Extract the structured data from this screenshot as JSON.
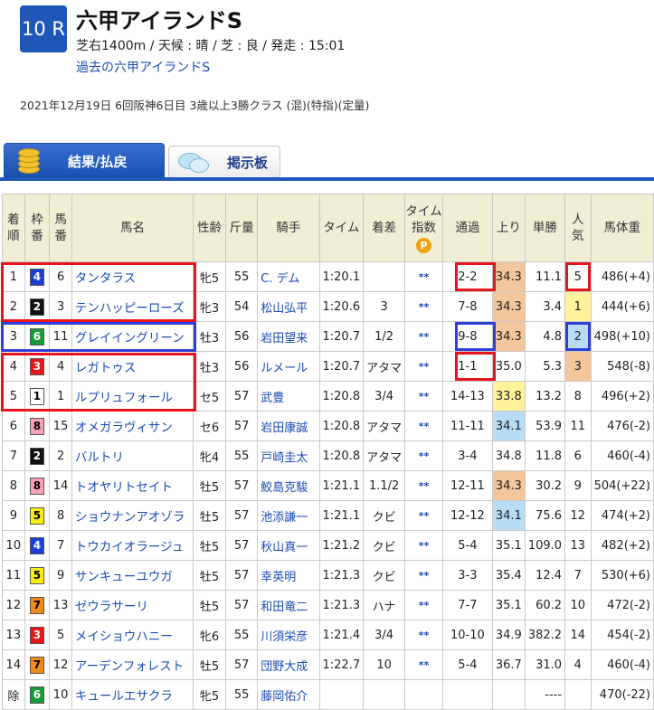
{
  "race": {
    "number": "10 R",
    "title": "六甲アイランドS",
    "info": "芝右1400m / 天候 : 晴 / 芝 : 良 / 発走 : 15:01",
    "past_link": "過去の六甲アイランドS",
    "date_line": "2021年12月19日 6回阪神6日目 3歳以上3勝クラス (混)(特指)(定量)"
  },
  "tabs": [
    {
      "label": "結果/払戻",
      "active": true,
      "icon": "coin-stack-icon"
    },
    {
      "label": "掲示板",
      "active": false,
      "icon": "speech-bubble-icon"
    }
  ],
  "table": {
    "headers": {
      "rank": "着\n順",
      "waku": "枠\n番",
      "umaban": "馬\n番",
      "name": "馬名",
      "sexage": "性齢",
      "weight": "斤量",
      "jockey": "騎手",
      "time": "タイム",
      "margin": "着差",
      "index": "タイム\n指数",
      "passing": "通過",
      "last3f": "上り",
      "odds": "単勝",
      "pop": "人\n気",
      "bodyweight": "馬体重"
    },
    "rows": [
      {
        "rank": "1",
        "waku": "4",
        "umaban": "6",
        "name": "タンタラス",
        "sexage": "牝5",
        "weight": "55",
        "jockey": "C. デム",
        "time": "1:20.1",
        "margin": "",
        "index": "**",
        "passing": "2-2",
        "last3f": "34.3",
        "odds": "11.1",
        "pop": "5",
        "bodyweight": "486(+4)"
      },
      {
        "rank": "2",
        "waku": "2",
        "umaban": "3",
        "name": "テンハッピーローズ",
        "sexage": "牝3",
        "weight": "54",
        "jockey": "松山弘平",
        "time": "1:20.6",
        "margin": "3",
        "index": "**",
        "passing": "7-8",
        "last3f": "34.3",
        "odds": "3.4",
        "pop": "1",
        "bodyweight": "444(+6)"
      },
      {
        "rank": "3",
        "waku": "6",
        "umaban": "11",
        "name": "グレイイングリーン",
        "sexage": "牡3",
        "weight": "56",
        "jockey": "岩田望来",
        "time": "1:20.7",
        "margin": "1/2",
        "index": "**",
        "passing": "9-8",
        "last3f": "34.3",
        "odds": "4.8",
        "pop": "2",
        "bodyweight": "498(+10)"
      },
      {
        "rank": "4",
        "waku": "3",
        "umaban": "4",
        "name": "レガトゥス",
        "sexage": "牡3",
        "weight": "56",
        "jockey": "ルメール",
        "time": "1:20.7",
        "margin": "アタマ",
        "index": "**",
        "passing": "1-1",
        "last3f": "35.0",
        "odds": "5.3",
        "pop": "3",
        "bodyweight": "548(-8)"
      },
      {
        "rank": "5",
        "waku": "1",
        "umaban": "1",
        "name": "ルプリュフォール",
        "sexage": "セ5",
        "weight": "57",
        "jockey": "武豊",
        "time": "1:20.8",
        "margin": "3/4",
        "index": "**",
        "passing": "14-13",
        "last3f": "33.8",
        "odds": "13.2",
        "pop": "8",
        "bodyweight": "496(+2)"
      },
      {
        "rank": "6",
        "waku": "8",
        "umaban": "15",
        "name": "オメガラヴィサン",
        "sexage": "セ6",
        "weight": "57",
        "jockey": "岩田康誠",
        "time": "1:20.8",
        "margin": "アタマ",
        "index": "**",
        "passing": "11-11",
        "last3f": "34.1",
        "odds": "53.9",
        "pop": "11",
        "bodyweight": "476(-2)"
      },
      {
        "rank": "7",
        "waku": "2",
        "umaban": "2",
        "name": "バルトリ",
        "sexage": "牝4",
        "weight": "55",
        "jockey": "戸崎圭太",
        "time": "1:20.8",
        "margin": "アタマ",
        "index": "**",
        "passing": "3-4",
        "last3f": "34.8",
        "odds": "11.8",
        "pop": "6",
        "bodyweight": "460(-4)"
      },
      {
        "rank": "8",
        "waku": "8",
        "umaban": "14",
        "name": "トオヤリトセイト",
        "sexage": "牡5",
        "weight": "57",
        "jockey": "鮫島克駿",
        "time": "1:21.1",
        "margin": "1.1/2",
        "index": "**",
        "passing": "12-11",
        "last3f": "34.3",
        "odds": "30.2",
        "pop": "9",
        "bodyweight": "504(+22)"
      },
      {
        "rank": "9",
        "waku": "5",
        "umaban": "8",
        "name": "ショウナンアオゾラ",
        "sexage": "牡5",
        "weight": "57",
        "jockey": "池添謙一",
        "time": "1:21.1",
        "margin": "クビ",
        "index": "**",
        "passing": "12-12",
        "last3f": "34.1",
        "odds": "75.6",
        "pop": "12",
        "bodyweight": "474(+2)"
      },
      {
        "rank": "10",
        "waku": "4",
        "umaban": "7",
        "name": "トウカイオラージュ",
        "sexage": "牡5",
        "weight": "57",
        "jockey": "秋山真一",
        "time": "1:21.2",
        "margin": "クビ",
        "index": "**",
        "passing": "5-4",
        "last3f": "35.1",
        "odds": "109.0",
        "pop": "13",
        "bodyweight": "482(+2)"
      },
      {
        "rank": "11",
        "waku": "5",
        "umaban": "9",
        "name": "サンキューユウガ",
        "sexage": "牡5",
        "weight": "57",
        "jockey": "幸英明",
        "time": "1:21.3",
        "margin": "クビ",
        "index": "**",
        "passing": "3-3",
        "last3f": "35.4",
        "odds": "12.4",
        "pop": "7",
        "bodyweight": "530(+6)"
      },
      {
        "rank": "12",
        "waku": "7",
        "umaban": "13",
        "name": "ゼウラサーリ",
        "sexage": "牡5",
        "weight": "57",
        "jockey": "和田竜二",
        "time": "1:21.3",
        "margin": "ハナ",
        "index": "**",
        "passing": "7-7",
        "last3f": "35.1",
        "odds": "60.2",
        "pop": "10",
        "bodyweight": "472(-2)"
      },
      {
        "rank": "13",
        "waku": "3",
        "umaban": "5",
        "name": "メイショウハニー",
        "sexage": "牝6",
        "weight": "55",
        "jockey": "川須栄彦",
        "time": "1:21.4",
        "margin": "3/4",
        "index": "**",
        "passing": "10-10",
        "last3f": "34.9",
        "odds": "382.2",
        "pop": "14",
        "bodyweight": "454(-2)"
      },
      {
        "rank": "14",
        "waku": "7",
        "umaban": "12",
        "name": "アーデンフォレスト",
        "sexage": "牡5",
        "weight": "57",
        "jockey": "団野大成",
        "time": "1:22.7",
        "margin": "10",
        "index": "**",
        "passing": "5-4",
        "last3f": "36.7",
        "odds": "31.0",
        "pop": "4",
        "bodyweight": "460(-4)"
      },
      {
        "rank": "除",
        "waku": "6",
        "umaban": "10",
        "name": "キュールエサクラ",
        "sexage": "牝5",
        "weight": "55",
        "jockey": "藤岡佑介",
        "time": "",
        "margin": "",
        "index": "",
        "passing": "",
        "last3f": "",
        "odds": "----",
        "pop": "",
        "bodyweight": "470(-22)"
      }
    ]
  },
  "colors": {
    "accent": "#1e57b8",
    "header_bg": "#f1eed6",
    "annotation_red": "#e8141c",
    "annotation_blue": "#2d3fd6"
  }
}
